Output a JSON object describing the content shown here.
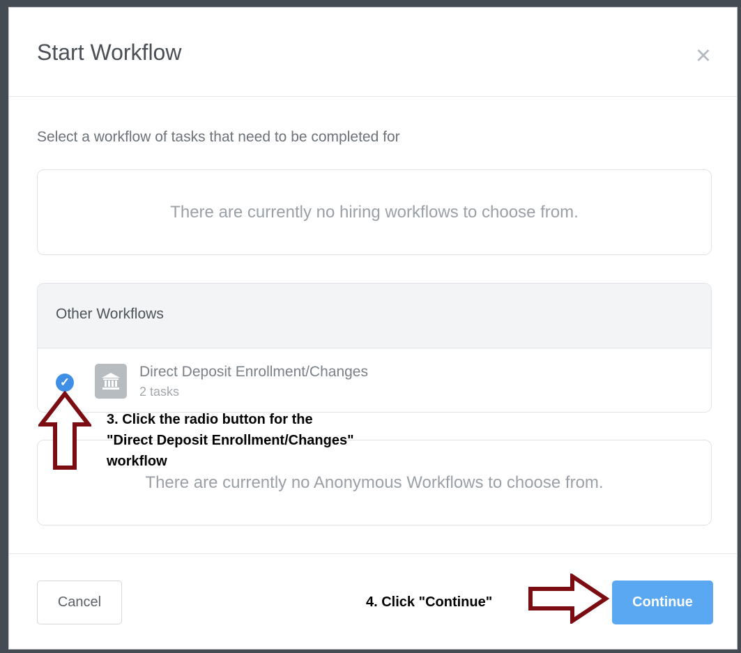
{
  "modal": {
    "title": "Start Workflow",
    "close_glyph": "×",
    "intro": "Select a workflow of tasks that need to be completed for",
    "hiring_empty": "There are currently no hiring workflows to choose from.",
    "other_workflows": {
      "title": "Other Workflows",
      "items": [
        {
          "name": "Direct Deposit Enrollment/Changes",
          "meta": "2 tasks",
          "selected": true,
          "icon": "bank-icon"
        }
      ]
    },
    "anonymous_empty": "There are currently no Anonymous Workflows to choose from.",
    "footer": {
      "cancel_label": "Cancel",
      "continue_label": "Continue"
    }
  },
  "annotations": {
    "step3_lines": [
      "3. Click the radio button for the",
      "\"Direct Deposit Enrollment/Changes\"",
      "workflow"
    ],
    "step4": "4. Click \"Continue\""
  },
  "colors": {
    "accent": "#3f8fe6",
    "continue_button": "#5aa7f2",
    "annotation_arrow": "#7a0c12"
  }
}
